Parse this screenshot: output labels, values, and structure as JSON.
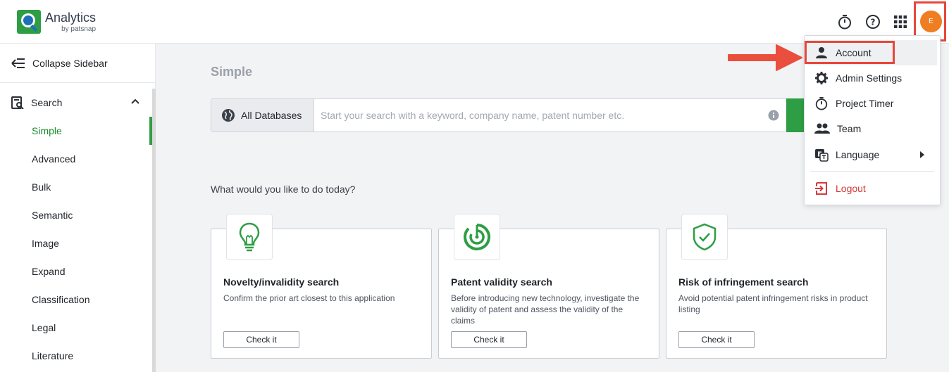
{
  "colors": {
    "accent": "#2e9e44",
    "highlight_box": "#e8463a",
    "avatar": "#ef7d22",
    "logout": "#d53a3a"
  },
  "header": {
    "logo_title": "Analytics",
    "logo_sub": "by patsnap",
    "icons": [
      "timer-icon",
      "help-icon",
      "apps-grid-icon"
    ],
    "avatar_initial": "E"
  },
  "sidebar": {
    "collapse_label": "Collapse Sidebar",
    "section_label": "Search",
    "items": [
      {
        "label": "Simple",
        "active": true
      },
      {
        "label": "Advanced"
      },
      {
        "label": "Bulk"
      },
      {
        "label": "Semantic"
      },
      {
        "label": "Image"
      },
      {
        "label": "Expand"
      },
      {
        "label": "Classification"
      },
      {
        "label": "Legal"
      },
      {
        "label": "Literature"
      }
    ]
  },
  "main": {
    "title": "Simple",
    "search": {
      "database_label": "All Databases",
      "placeholder": "Start your search with a keyword, company name, patent number etc."
    },
    "prompt": "What would you like to do today?",
    "cards": [
      {
        "title": "Novelty/invalidity search",
        "description": "Confirm the prior art closest to this application",
        "button": "Check it",
        "icon": "lightbulb-icon"
      },
      {
        "title": "Patent validity search",
        "description": "Before introducing new technology, investigate the validity of patent and assess the validity of the claims",
        "button": "Check it",
        "icon": "target-icon"
      },
      {
        "title": "Risk of infringement search",
        "description": "Avoid potential patent infringement risks in product listing",
        "button": "Check it",
        "icon": "shield-check-icon"
      }
    ]
  },
  "user_menu": {
    "items": [
      {
        "label": "Account",
        "icon": "person-icon"
      },
      {
        "label": "Admin Settings",
        "icon": "gear-icon"
      },
      {
        "label": "Project Timer",
        "icon": "timer-icon"
      },
      {
        "label": "Team",
        "icon": "team-icon"
      },
      {
        "label": "Language",
        "icon": "language-icon"
      }
    ],
    "logout": {
      "label": "Logout",
      "icon": "logout-icon"
    }
  }
}
